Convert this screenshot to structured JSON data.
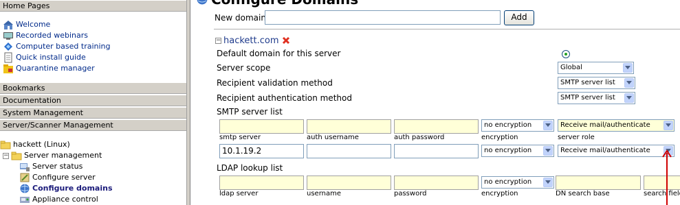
{
  "nav": {
    "home_pages": "Home Pages",
    "links": [
      {
        "label": "Welcome",
        "icon": "home-icon"
      },
      {
        "label": "Recorded webinars",
        "icon": "webinar-icon"
      },
      {
        "label": "Computer based training",
        "icon": "training-icon"
      },
      {
        "label": "Quick install guide",
        "icon": "document-icon"
      },
      {
        "label": "Quarantine manager",
        "icon": "quarantine-icon"
      }
    ],
    "sections": [
      "Bookmarks",
      "Documentation",
      "System Management",
      "Server/Scanner Management"
    ],
    "tree": {
      "root": "hackett (Linux)",
      "server_management": "Server management",
      "items": [
        {
          "label": "Server status",
          "icon": "server-status-icon"
        },
        {
          "label": "Configure server",
          "icon": "configure-server-icon"
        },
        {
          "label": "Configure domains",
          "icon": "configure-domains-icon"
        },
        {
          "label": "Appliance control",
          "icon": "appliance-icon"
        }
      ]
    }
  },
  "main": {
    "title": "Configure Domains",
    "new_domain_label": "New domain",
    "new_domain_value": "",
    "add_button": "Add",
    "domain_name": "hackett.com",
    "fields": {
      "default_domain": "Default domain for this server",
      "server_scope": "Server scope",
      "server_scope_value": "Global",
      "recipient_validation": "Recipient validation method",
      "recipient_validation_value": "SMTP server list",
      "recipient_auth": "Recipient authentication method",
      "recipient_auth_value": "SMTP server list"
    },
    "smtp": {
      "heading": "SMTP server list",
      "columns": [
        "smtp server",
        "auth username",
        "auth password",
        "encryption",
        "server role"
      ],
      "new_row": {
        "encryption": "no encryption",
        "role": "Receive mail/authenticate"
      },
      "row": {
        "server": "10.1.19.2",
        "username": "",
        "password": "",
        "encryption": "no encryption",
        "role": "Receive mail/authenticate"
      }
    },
    "ldap": {
      "heading": "LDAP lookup list",
      "columns": [
        "ldap server",
        "username",
        "password",
        "encryption",
        "DN search base",
        "search field"
      ],
      "new_row": {
        "encryption": "no encryption"
      }
    }
  },
  "colors": {
    "annotation_arrow": "#d00000",
    "input_highlight": "#ffffd8",
    "nav_header": "#d4d0c8"
  }
}
